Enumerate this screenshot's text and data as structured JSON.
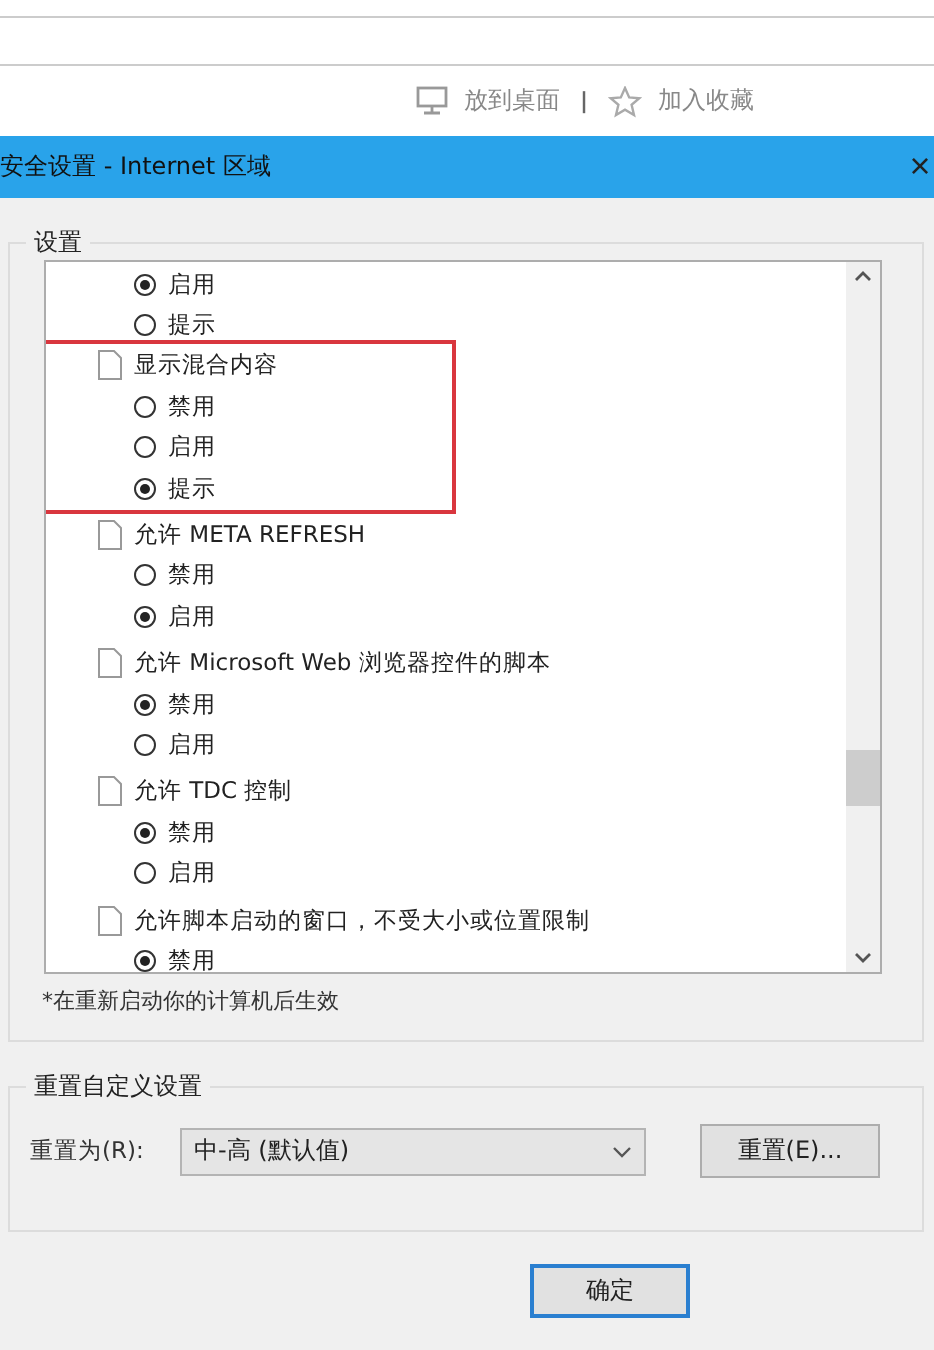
{
  "browser_toolbar": {
    "actions": [
      {
        "kind": "desktop",
        "label": "放到桌面"
      },
      {
        "kind": "favorite",
        "label": "加入收藏"
      }
    ],
    "separator": "|"
  },
  "window": {
    "title": "安全设置 - Internet 区域",
    "close": "×"
  },
  "settings": {
    "label": "设置",
    "groups": [
      {
        "options": [
          {
            "label": "启用",
            "selected": true
          },
          {
            "label": "提示",
            "selected": false
          }
        ]
      },
      {
        "label": "显示混合内容",
        "highlighted": true,
        "options": [
          {
            "label": "禁用",
            "selected": false
          },
          {
            "label": "启用",
            "selected": false
          },
          {
            "label": "提示",
            "selected": true
          }
        ]
      },
      {
        "label": "允许 META REFRESH",
        "highlighted": false,
        "options": [
          {
            "label": "禁用",
            "selected": false
          },
          {
            "label": "启用",
            "selected": true
          }
        ]
      },
      {
        "label": "允许 Microsoft Web 浏览器控件的脚本",
        "highlighted": false,
        "options": [
          {
            "label": "禁用",
            "selected": true
          },
          {
            "label": "启用",
            "selected": false
          }
        ]
      },
      {
        "label": "允许 TDC 控制",
        "highlighted": false,
        "options": [
          {
            "label": "禁用",
            "selected": true
          },
          {
            "label": "启用",
            "selected": false
          }
        ]
      },
      {
        "label": "允许脚本启动的窗口，不受大小或位置限制",
        "highlighted": false,
        "options": [
          {
            "label": "禁用",
            "selected": true
          }
        ]
      }
    ],
    "note": "*在重新启动你的计算机后生效"
  },
  "reset": {
    "label": "重置自定义设置",
    "field_label": "重置为(R):",
    "value": "中-高 (默认值)",
    "button": "重置(E)..."
  },
  "buttons": [
    {
      "label": "确定",
      "default": true
    }
  ]
}
